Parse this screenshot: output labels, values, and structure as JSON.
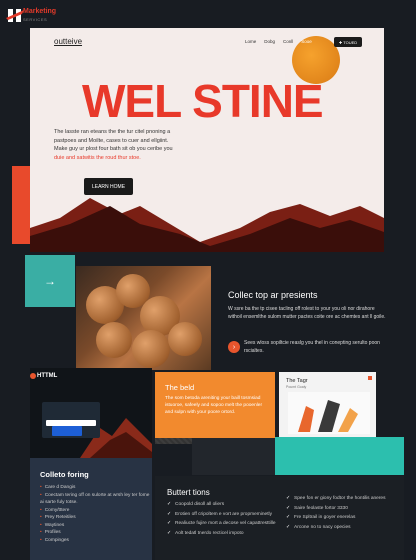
{
  "watermark": {
    "title": "Marketing",
    "subtitle": "SERVICES"
  },
  "hero": {
    "brand": "outteive",
    "nav": [
      "Lome",
      "Dobg",
      "Conll",
      "Sooe"
    ],
    "sign_in": "✚ TOUED",
    "headline": "WEL STINE",
    "copy_line1": "The lasste ran eteans the the tur citel pnoning a",
    "copy_line2": "pastpoes and Moilte, cases to cuer and ellgiint.",
    "copy_line3": "Make guy ur plost four bath sit ob you ceribe you",
    "copy_line4": "duie and satwitis the roud thur stoe.",
    "cta": "LEARN HOME"
  },
  "feature": {
    "arrow": "→",
    "title": "Collec top ar presients",
    "text": "W ssre ba the tp cisee tacling off rolest to your you oli nor dirahore withoil ensemlthe sulom mutter pactes coite ore ac chemtes ant ll goile.",
    "badge": "›",
    "note": "Sees wloss sopiltcie reaslg you thel in conepting serulto poon rscialtes."
  },
  "dashboard": {
    "logo": "HTTML"
  },
  "orange_card": {
    "title": "The beld",
    "text": "The som betoda areniting your baill tosmsiad istuoroe, safeely and sopoo melt the pooenler and sulpn with your poore ortord."
  },
  "mini_card": {
    "title": "The Tagr",
    "subtitle": "Poumt Goaly"
  },
  "list_panel": {
    "title": "Colleto foring",
    "items": [
      "Care d Dangis",
      "Coectam tering off on sulorte at wrsh ley ter fome ai sarte fuly totse.",
      "Comy/tttere",
      "Prey Reteitiles",
      "Waytines",
      "Profiles",
      "Compinges"
    ]
  },
  "checks": {
    "title": "Buttert tions",
    "col1": [
      "Coopold disoll all oliers",
      "Erotien off cripoltem e vort are propmeminetly",
      "Realiucte fujire mort a decose vel capattresttille",
      "Aolt tedatl tnerdo recticel impoto"
    ],
    "col2": [
      "Spee fon er giony fodtor the hontilis aneres",
      "Saire feolaste fortor 3330",
      "Fre Spltrail in goyer enerelas",
      "Arcone no to nacy opecies"
    ]
  }
}
